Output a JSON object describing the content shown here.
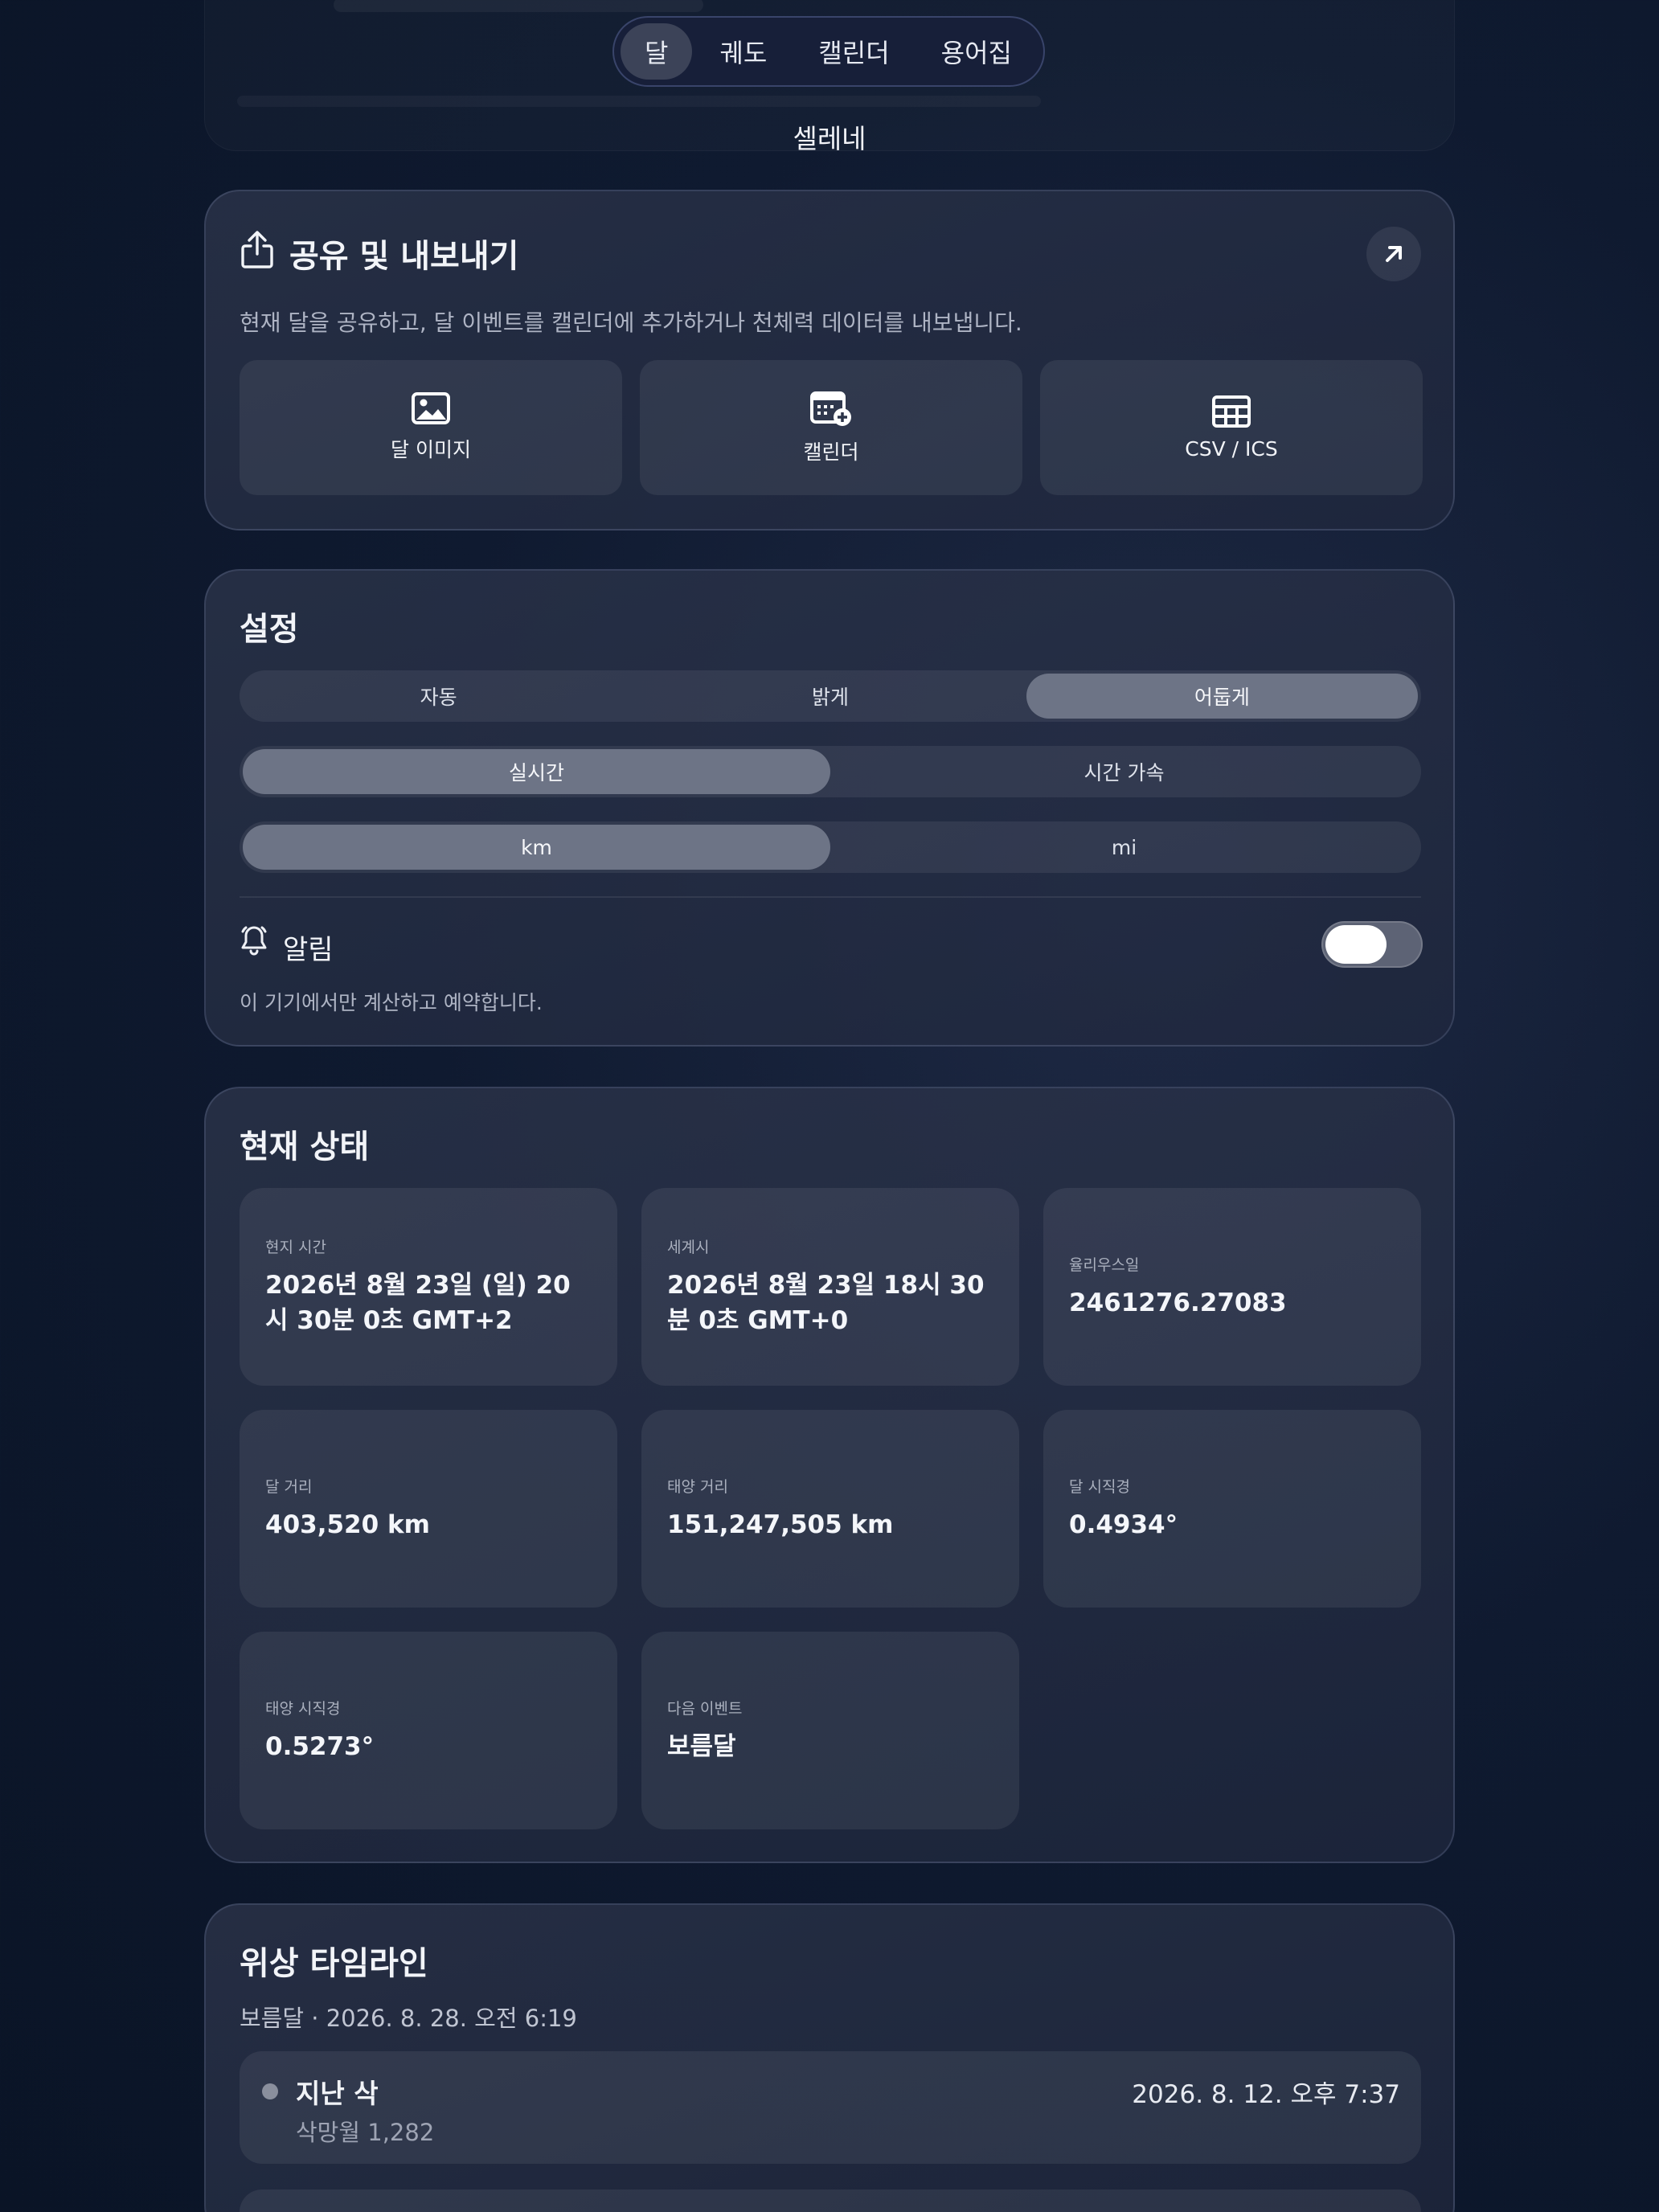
{
  "nav": {
    "tabs": [
      {
        "label": "달",
        "active": true
      },
      {
        "label": "궤도",
        "active": false
      },
      {
        "label": "캘린더",
        "active": false
      },
      {
        "label": "용어집",
        "active": false
      }
    ],
    "brand": "셀레네"
  },
  "share": {
    "title": "공유 및 내보내기",
    "description": "현재 달을 공유하고, 달 이벤트를 캘린더에 추가하거나 천체력 데이터를 내보냅니다.",
    "buttons": [
      {
        "label": "달 이미지",
        "icon": "image-icon"
      },
      {
        "label": "캘린더",
        "icon": "calendar-add-icon"
      },
      {
        "label": "CSV / ICS",
        "icon": "table-icon"
      }
    ]
  },
  "settings": {
    "title": "설정",
    "theme": {
      "options": [
        "자동",
        "밝게",
        "어둡게"
      ],
      "selected": "어둡게"
    },
    "time_mode": {
      "options": [
        "실시간",
        "시간 가속"
      ],
      "selected": "실시간"
    },
    "units": {
      "options": [
        "km",
        "mi"
      ],
      "selected": "km"
    },
    "notifications": {
      "label": "알림",
      "description": "이 기기에서만 계산하고 예약합니다."
    }
  },
  "status": {
    "title": "현재 상태",
    "items": [
      {
        "label": "현지 시간",
        "value": "2026년 8월 23일 (일) 20시 30분 0초 GMT+2"
      },
      {
        "label": "세계시",
        "value": "2026년 8월 23일 18시 30분 0초 GMT+0"
      },
      {
        "label": "율리우스일",
        "value": "2461276.27083"
      },
      {
        "label": "달 거리",
        "value": "403,520 km"
      },
      {
        "label": "태양 거리",
        "value": "151,247,505 km"
      },
      {
        "label": "달 시직경",
        "value": "0.4934°"
      },
      {
        "label": "태양 시직경",
        "value": "0.5273°"
      },
      {
        "label": "다음 이벤트",
        "value": "보름달"
      }
    ]
  },
  "timeline": {
    "title": "위상 타임라인",
    "subtitle": "보름달 · 2026. 8. 28. 오전 6:19",
    "items": [
      {
        "name": "지난 삭",
        "sub": "삭망월 1,282",
        "date": "2026. 8. 12. 오후 7:37"
      }
    ]
  },
  "colors": {
    "background": "#0f1a30",
    "card": "#2a3350",
    "selected_segment": "#6d7486",
    "accent_white": "#ffffff"
  }
}
